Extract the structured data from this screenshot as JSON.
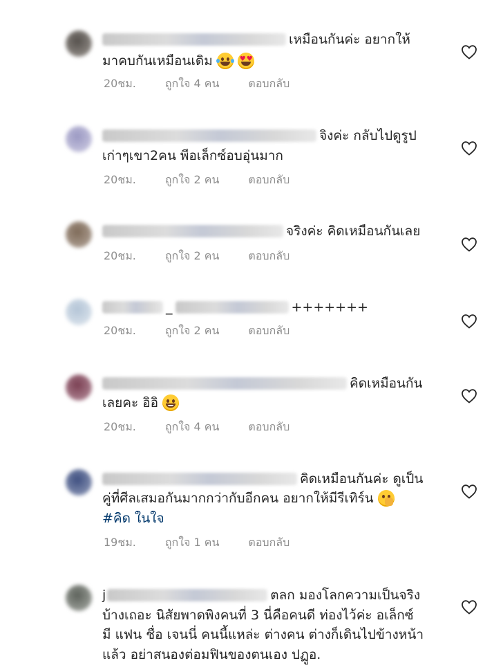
{
  "comments": [
    {
      "line1": "เหมือนกันค่ะ อยากให้",
      "line2": "มาคบกันเหมือนเดิม",
      "time": "20ชม.",
      "likes": "ถูกใจ 4 คน",
      "reply": "ตอบกลับ",
      "avatar_color": "#6f6a66"
    },
    {
      "line1": "จิงค่ะ กลับไปดูรูป",
      "line2": "เก่าๆเขา2คน พีอเล็กซ์อบอุ่นมาก",
      "time": "20ชม.",
      "likes": "ถูกใจ 2 คน",
      "reply": "ตอบกลับ",
      "avatar_color": "#a7a6c9"
    },
    {
      "line1": "จริงค่ะ คิดเหมือนกันเลย",
      "time": "20ชม.",
      "likes": "ถูกใจ 2 คน",
      "reply": "ตอบกลับ",
      "avatar_color": "#8c7a6a"
    },
    {
      "line1": "+++++++",
      "name_prefix": "_",
      "time": "20ชม.",
      "likes": "ถูกใจ 2 คน",
      "reply": "ตอบกลับ",
      "avatar_color": "#c5d1dd"
    },
    {
      "line1": "คิดเหมือนกัน",
      "line2": "เลยคะ อิอิ",
      "time": "20ชม.",
      "likes": "ถูกใจ 4 คน",
      "reply": "ตอบกลับ",
      "avatar_color": "#8e5a6b"
    },
    {
      "line1": "คิดเหมือนกันค่ะ ดูเป็น",
      "line2": "คู่ที่ศีลเสมอกันมากกว่ากับอีกคน อยากให้มีรีเทิร์น",
      "hashtag": "#คิด ในใจ",
      "time": "19ชม.",
      "likes": "ถูกใจ 1 คน",
      "reply": "ตอบกลับ",
      "avatar_color": "#5f6f92"
    },
    {
      "name_prefix": "j",
      "line1": "ตลก มองโลกความเป็นจริง",
      "line2": "บ้างเถอะ นิสัยพาดพิงคนที่ 3  นี่คือคนดี ท่องไว้ค่ะ อเล็กซ์",
      "line3": "มี แฟน ชื่อ เจนนี่ คนนี้แหล่ะ ต่างคน ต่างก็เดินไปข้างหน้า",
      "line4": "แล้ว อย่าสนองต่อมฟินของตนเอง ปฏูอ.",
      "avatar_color": "#7c807a"
    }
  ],
  "icons": {
    "heart": "heart-outline-icon",
    "emoji_laugh": "face-with-tears-of-joy-icon",
    "emoji_love": "heart-eyes-icon",
    "emoji_grin": "grinning-face-icon",
    "emoji_shh": "face-with-hand-over-mouth-icon"
  },
  "colors": {
    "text": "#262626",
    "meta": "#8e8e8e",
    "hashtag": "#00376b"
  }
}
